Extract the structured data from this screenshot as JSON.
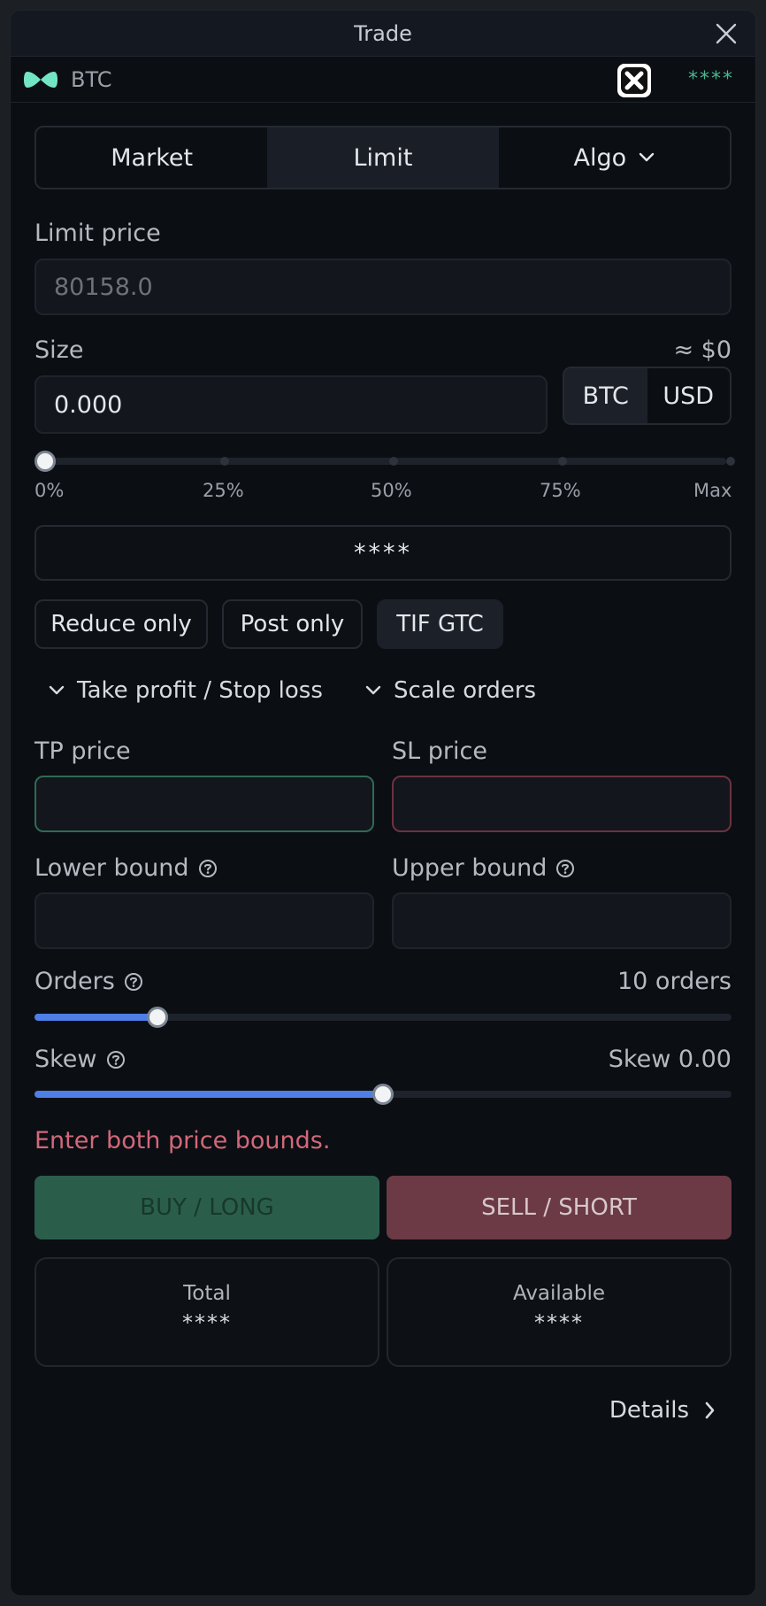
{
  "window": {
    "title": "Trade"
  },
  "asset": {
    "name": "BTC",
    "wallet_mask": "****"
  },
  "order_tabs": {
    "market": "Market",
    "limit": "Limit",
    "algo": "Algo",
    "active": "Limit"
  },
  "limit_price": {
    "label": "Limit price",
    "placeholder": "80158.0"
  },
  "size": {
    "label": "Size",
    "approx_value": "≈ $0",
    "value": "0.000",
    "units": [
      "BTC",
      "USD"
    ],
    "selected_unit": "BTC",
    "slider_value_percent": 0,
    "marks": [
      "0%",
      "25%",
      "50%",
      "75%",
      "Max"
    ]
  },
  "masked_button": {
    "label": "****"
  },
  "options": {
    "reduce_only": "Reduce only",
    "post_only": "Post only",
    "tif": "TIF GTC"
  },
  "sections": {
    "tp_sl": "Take profit / Stop loss",
    "scale": "Scale orders"
  },
  "tp": {
    "label": "TP price",
    "value": ""
  },
  "sl": {
    "label": "SL price",
    "value": ""
  },
  "lower_bound": {
    "label": "Lower bound",
    "value": ""
  },
  "upper_bound": {
    "label": "Upper bound",
    "value": ""
  },
  "orders": {
    "label": "Orders",
    "value_text": "10 orders",
    "slider_fraction": 0.177
  },
  "skew": {
    "label": "Skew",
    "value_text": "Skew 0.00",
    "slider_fraction": 0.5
  },
  "error_message": "Enter both price bounds.",
  "actions": {
    "buy": "BUY / LONG",
    "sell": "SELL / SHORT"
  },
  "stats": {
    "total": {
      "label": "Total",
      "value": "****"
    },
    "available": {
      "label": "Available",
      "value": "****"
    }
  },
  "details": {
    "label": "Details"
  },
  "colors": {
    "buy": "#2a5e4b",
    "sell": "#6b3a45",
    "accent": "#4e7fe6",
    "tp_border": "#2f6b55",
    "sl_border": "#6b3340",
    "error": "#d2687a"
  }
}
